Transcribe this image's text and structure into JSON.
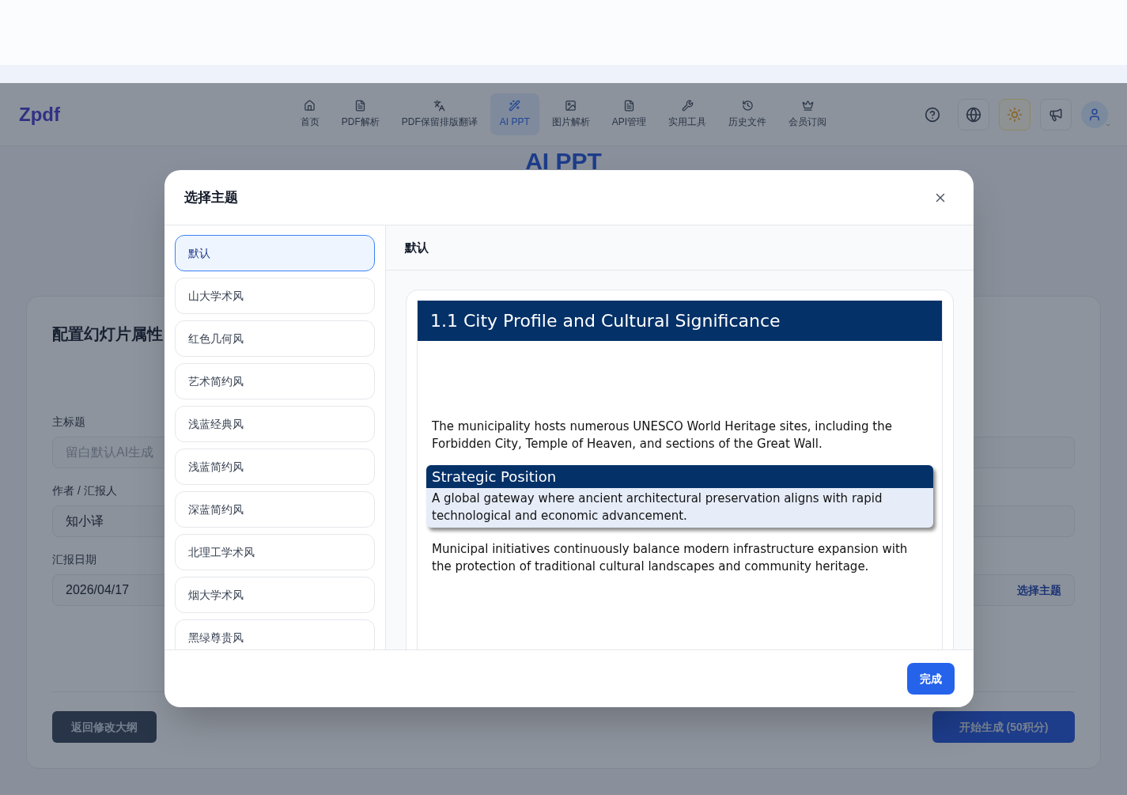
{
  "top_nav": {
    "logo": "Zpdf",
    "items": [
      {
        "label": "首页",
        "selected": false
      },
      {
        "label": "PDF解析",
        "selected": false
      },
      {
        "label": "PDF保留排版翻译",
        "selected": false
      },
      {
        "label": "AI PPT",
        "selected": true
      },
      {
        "label": "图片解析",
        "selected": false
      },
      {
        "label": "API管理",
        "selected": false
      },
      {
        "label": "实用工具",
        "selected": false
      },
      {
        "label": "历史文件",
        "selected": false
      },
      {
        "label": "会员订阅",
        "selected": false
      }
    ]
  },
  "page_title": "AI PPT",
  "form": {
    "heading": "配置幻灯片属性",
    "fields": [
      {
        "label": "主标题",
        "placeholder": "留白默认AI生成"
      },
      {
        "label": "作者 / 汇报人",
        "value": "知小译"
      },
      {
        "label": "汇报日期",
        "value": "2026/04/17"
      }
    ],
    "theme_button": "选择主题",
    "back_button": "返回修改大纲",
    "generate_button": "开始生成 (50积分)"
  },
  "modal": {
    "title": "选择主题",
    "themes": [
      {
        "label": "默认",
        "selected": true
      },
      {
        "label": "山大学术风",
        "selected": false
      },
      {
        "label": "红色几何风",
        "selected": false
      },
      {
        "label": "艺术简约风",
        "selected": false
      },
      {
        "label": "浅蓝经典风",
        "selected": false
      },
      {
        "label": "浅蓝简约风",
        "selected": false
      },
      {
        "label": "深蓝简约风",
        "selected": false
      },
      {
        "label": "北理工学术风",
        "selected": false
      },
      {
        "label": "烟大学术风",
        "selected": false
      },
      {
        "label": "黑绿尊贵风",
        "selected": false
      }
    ],
    "preview_title": "默认",
    "slide": {
      "title": "1.1 City Profile and Cultural Significance",
      "intro": "The municipality hosts numerous UNESCO World Heritage sites, including the Forbidden City, Temple of Heaven, and sections of the Great Wall.",
      "block_title": "Strategic Position",
      "block_body": "A global gateway where ancient architectural preservation aligns with rapid technological and economic advancement.",
      "closing": "Municipal initiatives continuously balance modern infrastructure expansion with the protection of traditional cultural landscapes and community heritage."
    },
    "done_button": "完成"
  }
}
